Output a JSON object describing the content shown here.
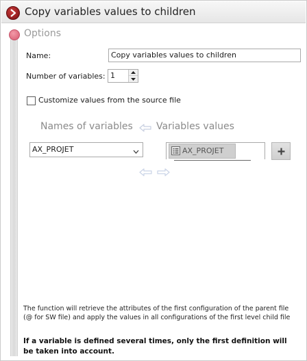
{
  "window": {
    "title": "Copy variables values to children"
  },
  "section": {
    "title": "Options"
  },
  "form": {
    "name_label": "Name:",
    "name_value": "Copy variables values to children",
    "num_vars_label": "Number of variables:",
    "num_vars_value": "1",
    "customize_label": "Customize values from the source file",
    "customize_checked": false
  },
  "columns": {
    "names_header": "Names of variables",
    "values_header": "Variables values"
  },
  "variables": [
    {
      "name": "AX_PROJET",
      "value": "AX_PROJET"
    }
  ],
  "footer": {
    "info_text": "The function will retrieve the attributes of the first configuration of the parent file (@ for SW file) and apply the values in all configurations of the first level child file",
    "warning_text": "If a variable is defined several times, only the first definition will be taken into account."
  },
  "colors": {
    "accent_red": "#8b1a1e",
    "section_dot": "#e07088",
    "muted_header": "#8a8a8a"
  },
  "icons": {
    "title": "chevron-right-icon",
    "arrow_left": "arrow-left-icon",
    "arrow_right": "arrow-right-icon",
    "add": "plus-icon",
    "variable_chip": "variable-list-icon",
    "combo": "chevron-down-icon"
  }
}
